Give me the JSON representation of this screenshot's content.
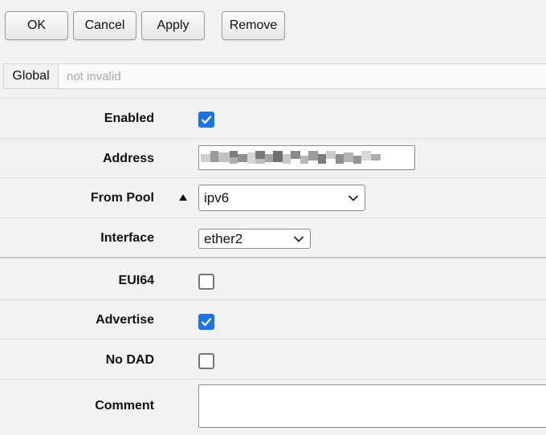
{
  "toolbar": {
    "ok_label": "OK",
    "cancel_label": "Cancel",
    "apply_label": "Apply",
    "remove_label": "Remove"
  },
  "tabs": {
    "active_label": "Global",
    "status_text": "not invalid"
  },
  "form": {
    "enabled": {
      "label": "Enabled",
      "checked": true
    },
    "address": {
      "label": "Address",
      "value": ""
    },
    "from_pool": {
      "label": "From Pool",
      "value": "ipv6"
    },
    "interface": {
      "label": "Interface",
      "value": "ether2"
    },
    "eui64": {
      "label": "EUI64",
      "checked": false
    },
    "advertise": {
      "label": "Advertise",
      "checked": true
    },
    "no_dad": {
      "label": "No DAD",
      "checked": false
    },
    "comment": {
      "label": "Comment",
      "value": ""
    }
  },
  "icons": {
    "checkmark": "checkmark-icon",
    "chevron": "chevron-down-icon",
    "collapse": "triangle-up-icon"
  },
  "colors": {
    "accent": "#1a73e8",
    "background": "#f2f2f2"
  }
}
